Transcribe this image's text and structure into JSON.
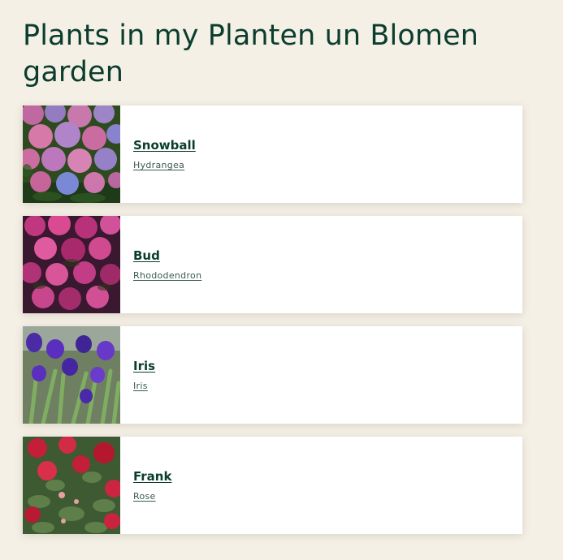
{
  "page": {
    "title": "Plants in my Planten un Blomen garden"
  },
  "plants": [
    {
      "name": "Snowball",
      "species": "Hydrangea"
    },
    {
      "name": "Bud",
      "species": "Rhododendron"
    },
    {
      "name": "Iris",
      "species": "Iris"
    },
    {
      "name": "Frank",
      "species": "Rose"
    }
  ],
  "colors": {
    "background": "#f5f0e6",
    "text": "#0b3d2e",
    "card": "#ffffff"
  }
}
